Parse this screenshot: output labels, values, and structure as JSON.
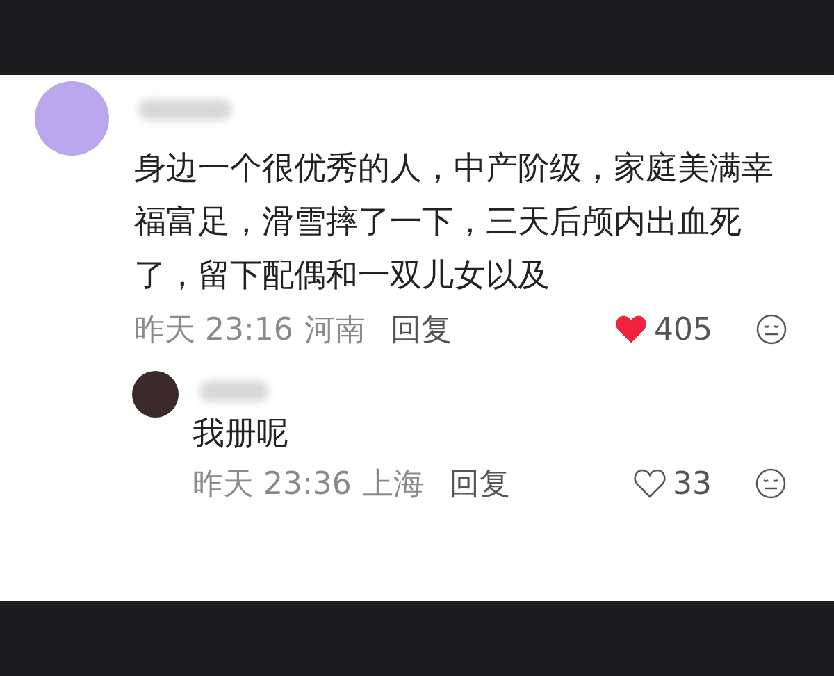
{
  "comments": [
    {
      "text": "身边一个很优秀的人，中产阶级，家庭美满幸福富足，滑雪摔了一下，三天后颅内出血死了，留下配偶和一双儿女以及",
      "time": "昨天 23:16",
      "location": "河南",
      "reply_label": "回复",
      "likes": "405",
      "liked": true,
      "reply": false
    },
    {
      "text": "我册呢",
      "time": "昨天 23:36",
      "location": "上海",
      "reply_label": "回复",
      "likes": "33",
      "liked": false,
      "reply": true
    }
  ]
}
